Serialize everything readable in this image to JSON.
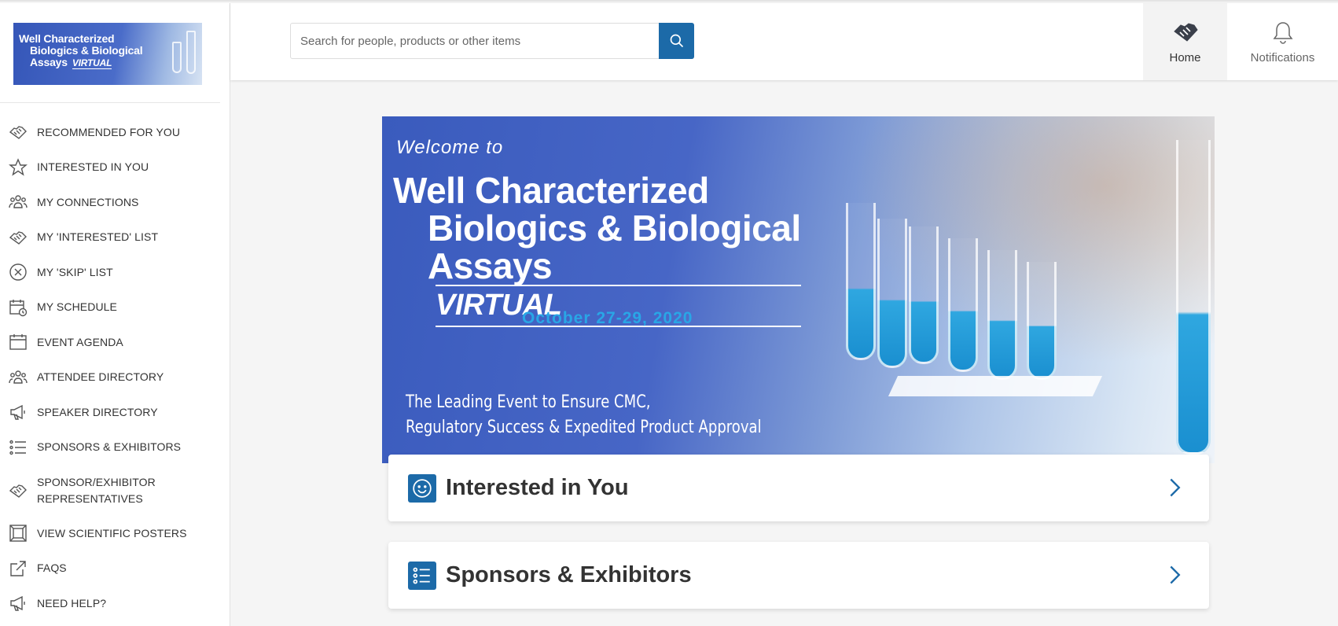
{
  "sidebar": {
    "logo": {
      "line1": "Well Characterized",
      "line2": "Biologics & Biological",
      "line3": "Assays",
      "virtual": "VIRTUAL"
    },
    "items": [
      {
        "label": "RECOMMENDED FOR YOU",
        "icon": "handshake-icon"
      },
      {
        "label": "INTERESTED IN YOU",
        "icon": "star-icon"
      },
      {
        "label": "MY CONNECTIONS",
        "icon": "people-icon"
      },
      {
        "label": "MY 'INTERESTED' LIST",
        "icon": "handshake-icon"
      },
      {
        "label": "MY 'SKIP' LIST",
        "icon": "close-circle-icon"
      },
      {
        "label": "MY SCHEDULE",
        "icon": "calendar-clock-icon"
      },
      {
        "label": "EVENT AGENDA",
        "icon": "calendar-icon"
      },
      {
        "label": "ATTENDEE DIRECTORY",
        "icon": "people-icon"
      },
      {
        "label": "SPEAKER DIRECTORY",
        "icon": "megaphone-icon"
      },
      {
        "label": "SPONSORS & EXHIBITORS",
        "icon": "list-icon"
      },
      {
        "label": "SPONSOR/EXHIBITOR REPRESENTATIVES",
        "icon": "handshake-icon"
      },
      {
        "label": "VIEW SCIENTIFIC POSTERS",
        "icon": "frame-icon"
      },
      {
        "label": "FAQS",
        "icon": "external-link-icon"
      },
      {
        "label": "NEED HELP?",
        "icon": "megaphone-icon"
      }
    ]
  },
  "header": {
    "search": {
      "placeholder": "Search for people, products or other items",
      "value": ""
    },
    "nav": [
      {
        "label": "Home",
        "icon": "handshake-icon",
        "active": true
      },
      {
        "label": "Notifications",
        "icon": "bell-icon",
        "active": false
      }
    ],
    "accent_color": "#1c6aa8"
  },
  "hero": {
    "welcome": "Welcome to",
    "title_line1": "Well Characterized",
    "title_line2": "Biologics & Biological",
    "title_line3": "Assays",
    "virtual": "VIRTUAL",
    "date": "October 27-29, 2020",
    "tagline_line1": "The Leading Event to Ensure CMC,",
    "tagline_line2": "Regulatory Success & Expedited Product Approval"
  },
  "cards": [
    {
      "title": "Interested in You",
      "icon": "smiley-icon"
    },
    {
      "title": "Sponsors & Exhibitors",
      "icon": "list-icon"
    }
  ]
}
